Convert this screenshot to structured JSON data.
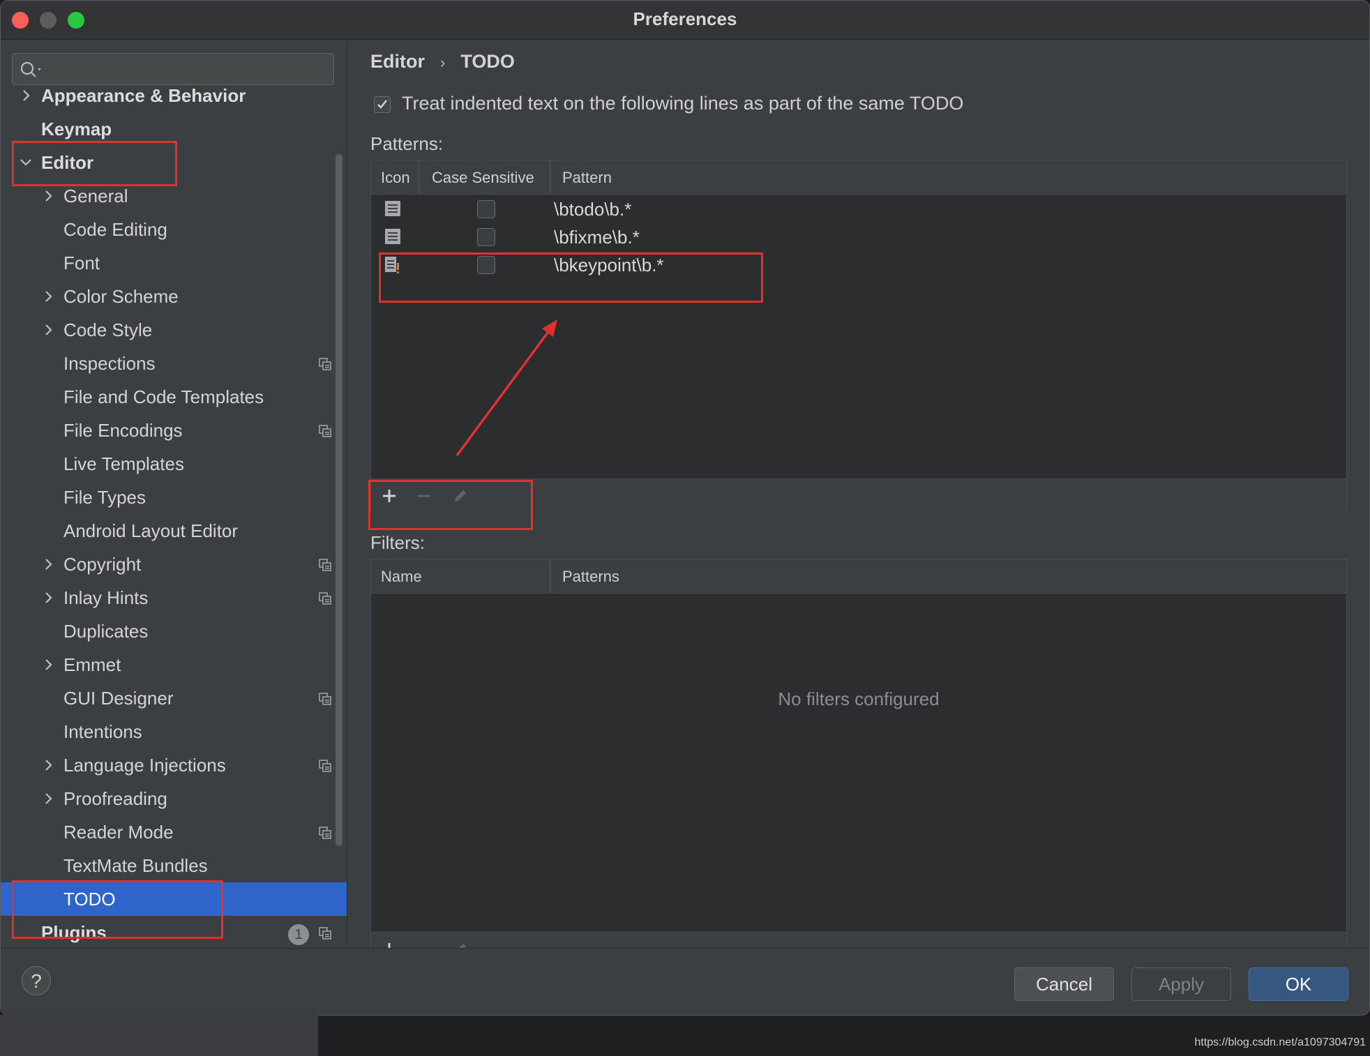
{
  "window": {
    "title": "Preferences"
  },
  "sidebar": {
    "search_placeholder": "",
    "items": [
      {
        "label": "Appearance & Behavior",
        "level": 0,
        "expandable": true,
        "overlay": false
      },
      {
        "label": "Keymap",
        "level": 0,
        "expandable": false,
        "overlay": false
      },
      {
        "label": "Editor",
        "level": 0,
        "expandable": true,
        "expanded": true,
        "overlay": false
      },
      {
        "label": "General",
        "level": 1,
        "expandable": true,
        "overlay": false
      },
      {
        "label": "Code Editing",
        "level": 1,
        "expandable": false,
        "overlay": false
      },
      {
        "label": "Font",
        "level": 1,
        "expandable": false,
        "overlay": false
      },
      {
        "label": "Color Scheme",
        "level": 1,
        "expandable": true,
        "overlay": false
      },
      {
        "label": "Code Style",
        "level": 1,
        "expandable": true,
        "overlay": false
      },
      {
        "label": "Inspections",
        "level": 1,
        "expandable": false,
        "overlay": true
      },
      {
        "label": "File and Code Templates",
        "level": 1,
        "expandable": false,
        "overlay": false
      },
      {
        "label": "File Encodings",
        "level": 1,
        "expandable": false,
        "overlay": true
      },
      {
        "label": "Live Templates",
        "level": 1,
        "expandable": false,
        "overlay": false
      },
      {
        "label": "File Types",
        "level": 1,
        "expandable": false,
        "overlay": false
      },
      {
        "label": "Android Layout Editor",
        "level": 1,
        "expandable": false,
        "overlay": false
      },
      {
        "label": "Copyright",
        "level": 1,
        "expandable": true,
        "overlay": true
      },
      {
        "label": "Inlay Hints",
        "level": 1,
        "expandable": true,
        "overlay": true
      },
      {
        "label": "Duplicates",
        "level": 1,
        "expandable": false,
        "overlay": false
      },
      {
        "label": "Emmet",
        "level": 1,
        "expandable": true,
        "overlay": false
      },
      {
        "label": "GUI Designer",
        "level": 1,
        "expandable": false,
        "overlay": true
      },
      {
        "label": "Intentions",
        "level": 1,
        "expandable": false,
        "overlay": false
      },
      {
        "label": "Language Injections",
        "level": 1,
        "expandable": true,
        "overlay": true
      },
      {
        "label": "Proofreading",
        "level": 1,
        "expandable": true,
        "overlay": false
      },
      {
        "label": "Reader Mode",
        "level": 1,
        "expandable": false,
        "overlay": true
      },
      {
        "label": "TextMate Bundles",
        "level": 1,
        "expandable": false,
        "overlay": false
      },
      {
        "label": "TODO",
        "level": 1,
        "expandable": false,
        "overlay": false,
        "selected": true
      },
      {
        "label": "Plugins",
        "level": 0,
        "expandable": false,
        "overlay": true,
        "badge": "1"
      }
    ]
  },
  "main": {
    "breadcrumb": [
      "Editor",
      "TODO"
    ],
    "treat_indented": {
      "label": "Treat indented text on the following lines as part of the same TODO",
      "checked": true
    },
    "patterns": {
      "label": "Patterns:",
      "columns": [
        "Icon",
        "Case Sensitive",
        "Pattern"
      ],
      "rows": [
        {
          "icon": "todo-icon",
          "case_sensitive": false,
          "pattern": "\\btodo\\b.*"
        },
        {
          "icon": "todo-icon",
          "case_sensitive": false,
          "pattern": "\\bfixme\\b.*"
        },
        {
          "icon": "todo-important-icon",
          "case_sensitive": false,
          "pattern": "\\bkeypoint\\b.*"
        }
      ]
    },
    "filters": {
      "label": "Filters:",
      "columns": [
        "Name",
        "Patterns"
      ],
      "empty_text": "No filters configured"
    }
  },
  "buttons": {
    "cancel": "Cancel",
    "apply": "Apply",
    "ok": "OK",
    "help": "?"
  },
  "footer_url": "https://blog.csdn.net/a1097304791",
  "colors": {
    "accent_selected": "#2f65ca",
    "annotation": "#e0312f",
    "ok_button": "#365880"
  }
}
